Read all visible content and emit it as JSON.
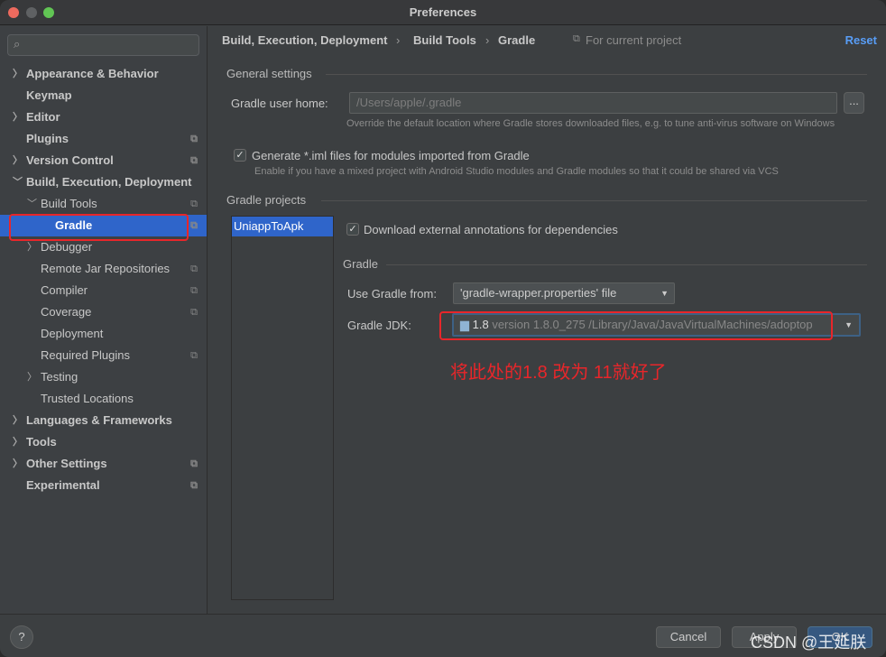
{
  "window": {
    "title": "Preferences"
  },
  "sidebar": {
    "search_placeholder": "",
    "items": [
      {
        "label": "Appearance & Behavior"
      },
      {
        "label": "Keymap"
      },
      {
        "label": "Editor"
      },
      {
        "label": "Plugins"
      },
      {
        "label": "Version Control"
      },
      {
        "label": "Build, Execution, Deployment"
      },
      {
        "label": "Build Tools"
      },
      {
        "label": "Gradle"
      },
      {
        "label": "Debugger"
      },
      {
        "label": "Remote Jar Repositories"
      },
      {
        "label": "Compiler"
      },
      {
        "label": "Coverage"
      },
      {
        "label": "Deployment"
      },
      {
        "label": "Required Plugins"
      },
      {
        "label": "Testing"
      },
      {
        "label": "Trusted Locations"
      },
      {
        "label": "Languages & Frameworks"
      },
      {
        "label": "Tools"
      },
      {
        "label": "Other Settings"
      },
      {
        "label": "Experimental"
      }
    ]
  },
  "breadcrumb": {
    "items": [
      "Build, Execution, Deployment",
      "Build Tools",
      "Gradle"
    ],
    "scope": "For current project",
    "reset": "Reset"
  },
  "general": {
    "title": "General settings",
    "user_home_label": "Gradle user home:",
    "user_home_value": "/Users/apple/.gradle",
    "browse": "...",
    "user_home_hint": "Override the default location where Gradle stores downloaded files, e.g. to tune anti-virus software on Windows",
    "iml_label": "Generate *.iml files for modules imported from Gradle",
    "iml_checked": true,
    "iml_hint": "Enable if you have a mixed project with Android Studio modules and Gradle modules so that it could be shared via VCS"
  },
  "projects": {
    "title": "Gradle projects",
    "list": [
      "UniappToApk"
    ],
    "annotations_label": "Download external annotations for dependencies",
    "annotations_checked": true,
    "gradle_title": "Gradle",
    "use_from_label": "Use Gradle from:",
    "use_from_value": "'gradle-wrapper.properties' file",
    "jdk_label": "Gradle JDK:",
    "jdk_name": "1.8",
    "jdk_detail": "version 1.8.0_275 /Library/Java/JavaVirtualMachines/adoptop"
  },
  "annotation": {
    "text": "将此处的1.8 改为 11就好了",
    "color": "#e8262a"
  },
  "footer": {
    "help": "?",
    "cancel": "Cancel",
    "apply": "Apply",
    "ok": "OK"
  },
  "watermark": "CSDN @王延朕"
}
